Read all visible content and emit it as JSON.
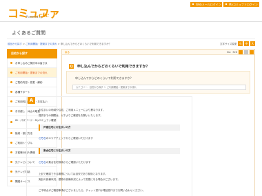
{
  "header": {
    "logo": "コミュファ",
    "logo_powered": "Powered by",
    "logo_brand": "ctc",
    "btn_web": "Webメールログイン",
    "btn_mycommufa": "Myコミュファログイン"
  },
  "page_title": "よくあるご質問",
  "breadcrumb": {
    "home": "前回から探す",
    "sep1": " > ",
    "cat": "ご利用開始・提案までの流れ",
    "sep2": " > ",
    "current": "申し込んでからどのくらいで利用できますか？"
  },
  "font_size": {
    "label": "文字サイズ変更",
    "small": "小",
    "medium": "中",
    "large": "大"
  },
  "sidebar": {
    "head": "目的から探す",
    "items": [
      {
        "label": "お申し込みご検討中の皆さま"
      },
      {
        "label": "ご利用開始・提案までの流れ"
      },
      {
        "label": "ご契約内容・変更・解約"
      },
      {
        "label": "各種サポート"
      },
      {
        "label": "ご利用料金の確認・お支払い"
      },
      {
        "label": "お引越し・休止の取扱"
      },
      {
        "label": "ID・パスワード・Myコミュファ確認",
        "tall": true
      },
      {
        "label": "接続・設定方法"
      },
      {
        "label": "ご利用トラブル"
      },
      {
        "label": "お客様の個人情報"
      },
      {
        "label": "光テレビについて"
      },
      {
        "label": "光テレビ電話"
      },
      {
        "label": "関連サービス"
      }
    ]
  },
  "main": {
    "back": "戻る",
    "no_label": "No：326",
    "q_mark": "Q",
    "question": "申し込んでからどのくらいで利用できますか？",
    "question_sub": "申し込んでからどのくらいで利用できますか？",
    "category": "カテゴリー：目的から探す ＞ ご利用開始・提案までの流れ",
    "a_mark": "A",
    "answer_lines": [
      "お住まいの地域や住宅、ご利用メニューにより異なります。",
      "提供までの期間は、以下よりご確認をお願いいたします。"
    ],
    "section1": "戸建住宅にお住まいの方",
    "section1_link": "こちら",
    "section1_text": "のエリアチェックからご確認いただけます",
    "section2": "集合住宅にお住まいの方",
    "section2_link": "こちら",
    "section2_text": "の集合住宅検索からご確認いただけます",
    "more_lines": [
      "上記で確認できる期間については目安であり前後となります。",
      "実記の設備状況、建物の設備状況によって変更になる場合がございます。"
    ],
    "footer_line": "ご不明点がご確認事項がございましたら、チャット窓口か電話窓口までお問い合わせください。"
  },
  "colors": {
    "accent": "#f39800",
    "link": "#3366cc"
  }
}
